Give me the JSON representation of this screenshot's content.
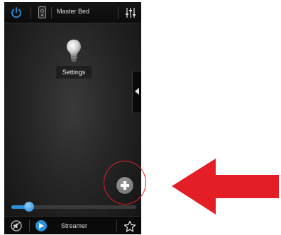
{
  "header": {
    "room_name": "Master Bed"
  },
  "main": {
    "settings_label": "Settings"
  },
  "volume": {
    "level": 0.14
  },
  "footer": {
    "source_name": "Streamer"
  },
  "colors": {
    "accent": "#2a8fdc",
    "annotation": "#e41e26"
  },
  "icons": {
    "power": "power-icon",
    "device": "device-icon",
    "eq": "equalizer-icon",
    "bulb": "light-bulb-icon",
    "side_tab": "chevron-left-icon",
    "add": "plus-icon",
    "mute": "mute-icon",
    "play": "play-icon",
    "favorite": "star-icon",
    "arrow": "arrow-left-icon"
  }
}
